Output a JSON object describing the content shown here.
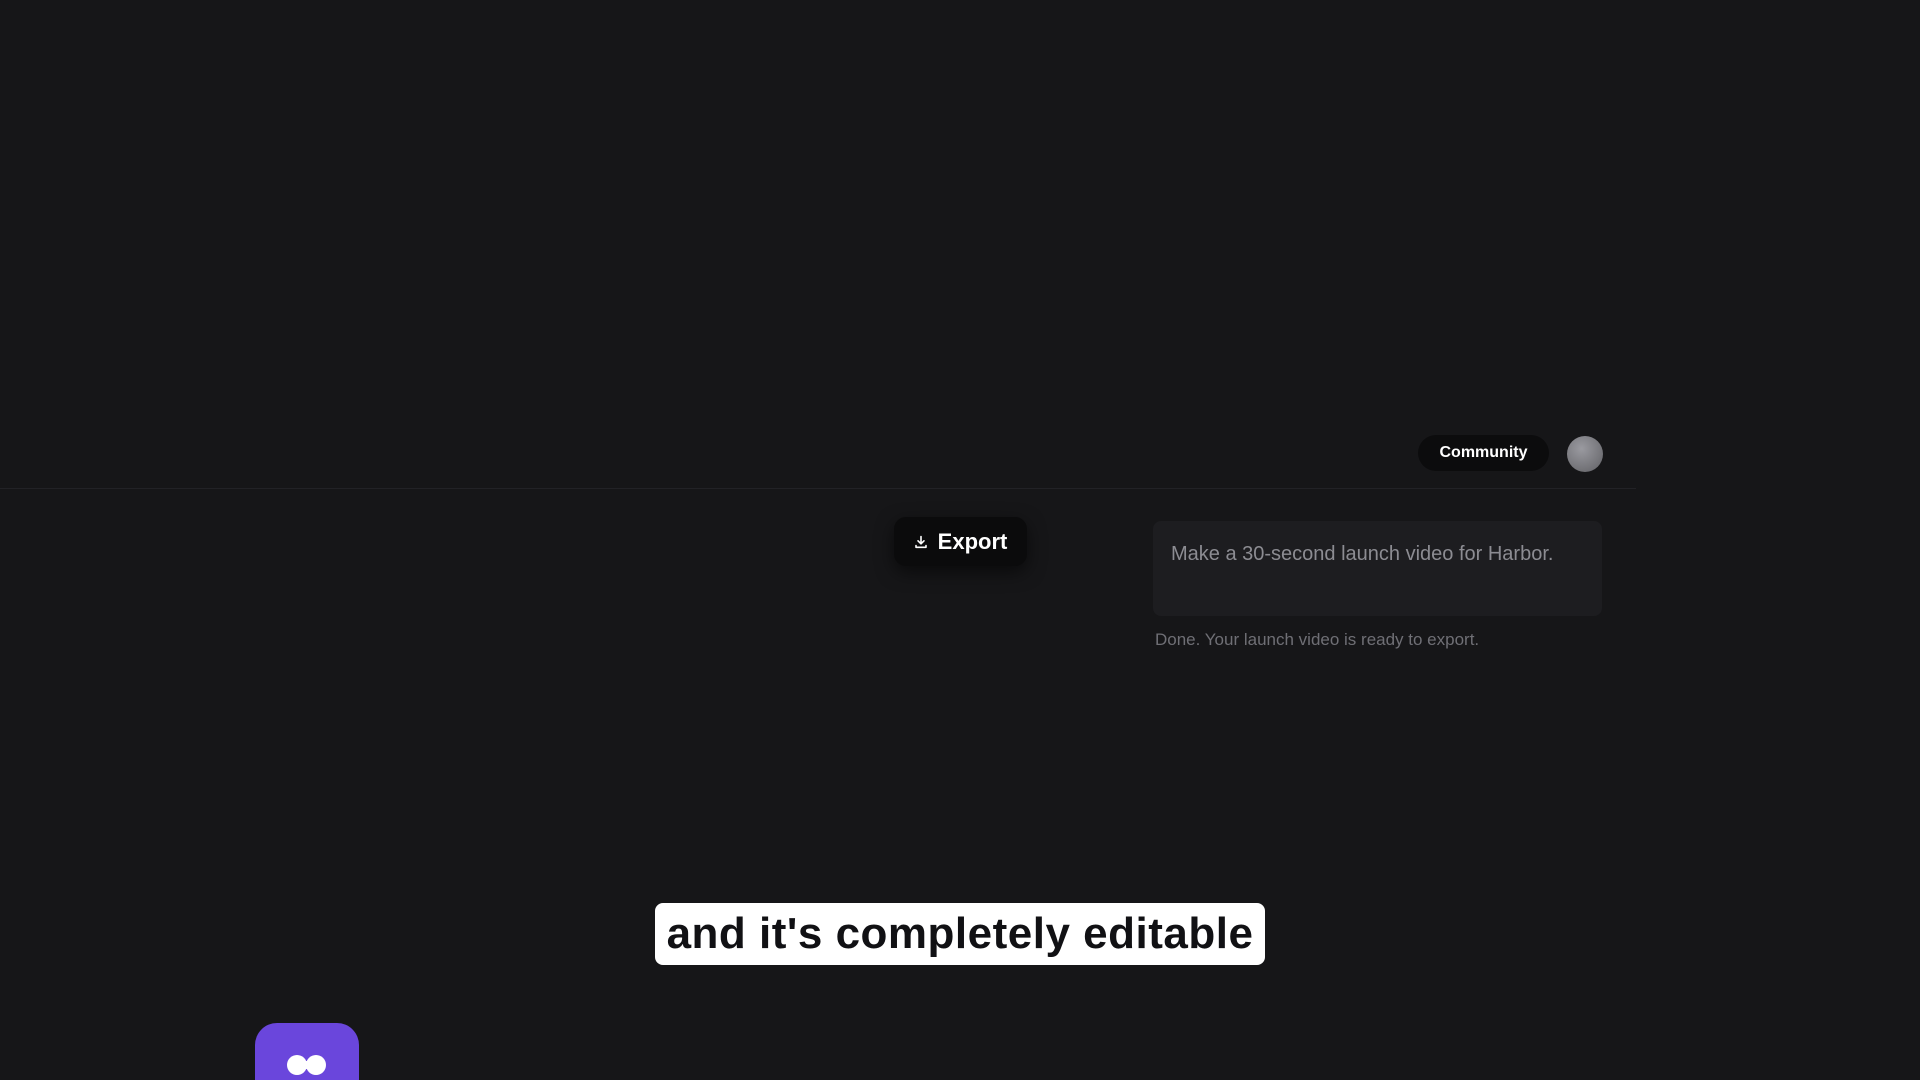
{
  "header": {
    "community_label": "Community"
  },
  "toolbar": {
    "export_label": "Export"
  },
  "chat": {
    "prompt_text": "Make a 30-second launch video for Harbor.",
    "status_text": "Done. Your launch video is ready to export."
  },
  "video": {
    "caption_text": "and it's completely editable"
  },
  "colors": {
    "background": "#161618",
    "accent": "#6a46dc",
    "button_bg": "#0b0b0c",
    "caption_bg": "#ffffff"
  },
  "icons": {
    "export": "download-icon",
    "app": "app-logo-icon"
  }
}
